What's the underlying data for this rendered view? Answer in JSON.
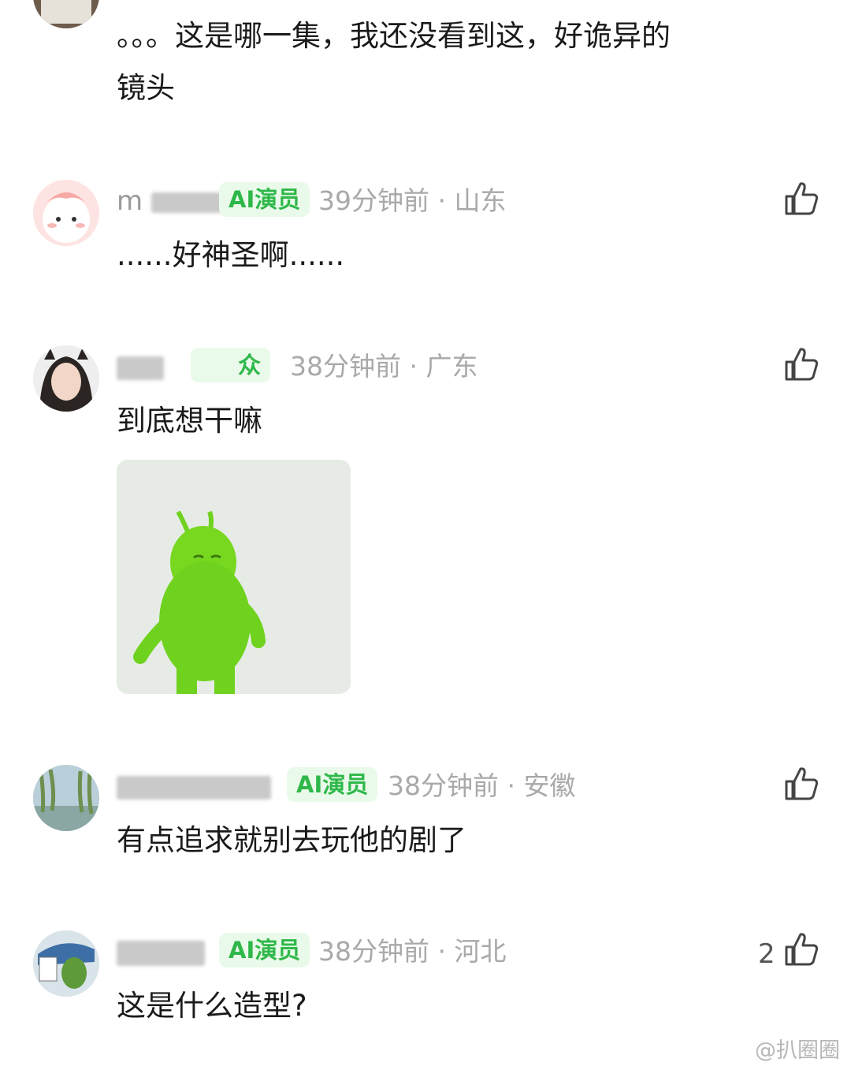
{
  "comments": [
    {
      "text_line1": "。。。这是哪一集，我还没看到这，好诡异的",
      "text_line2": "镜头"
    },
    {
      "name_visible": "m",
      "badge": "AI演员",
      "meta": "39分钟前 · 山东",
      "text": "......好神圣啊......"
    },
    {
      "badge": "众",
      "meta": "38分钟前 · 广东",
      "text": "到底想干嘛",
      "image": "green-dancing-creature-sticker"
    },
    {
      "badge": "AI演员",
      "meta": "38分钟前 · 安徽",
      "text": "有点追求就别去玩他的剧了"
    },
    {
      "badge": "AI演员",
      "meta": "38分钟前 · 河北",
      "text": "这是什么造型?",
      "likes": "2"
    }
  ],
  "icons": {
    "like": "thumbs-up-icon"
  },
  "colors": {
    "badge_bg": "#eafaea",
    "badge_text": "#2fb84a",
    "meta": "#a9a9a9"
  },
  "watermark": "@扒圈圈"
}
